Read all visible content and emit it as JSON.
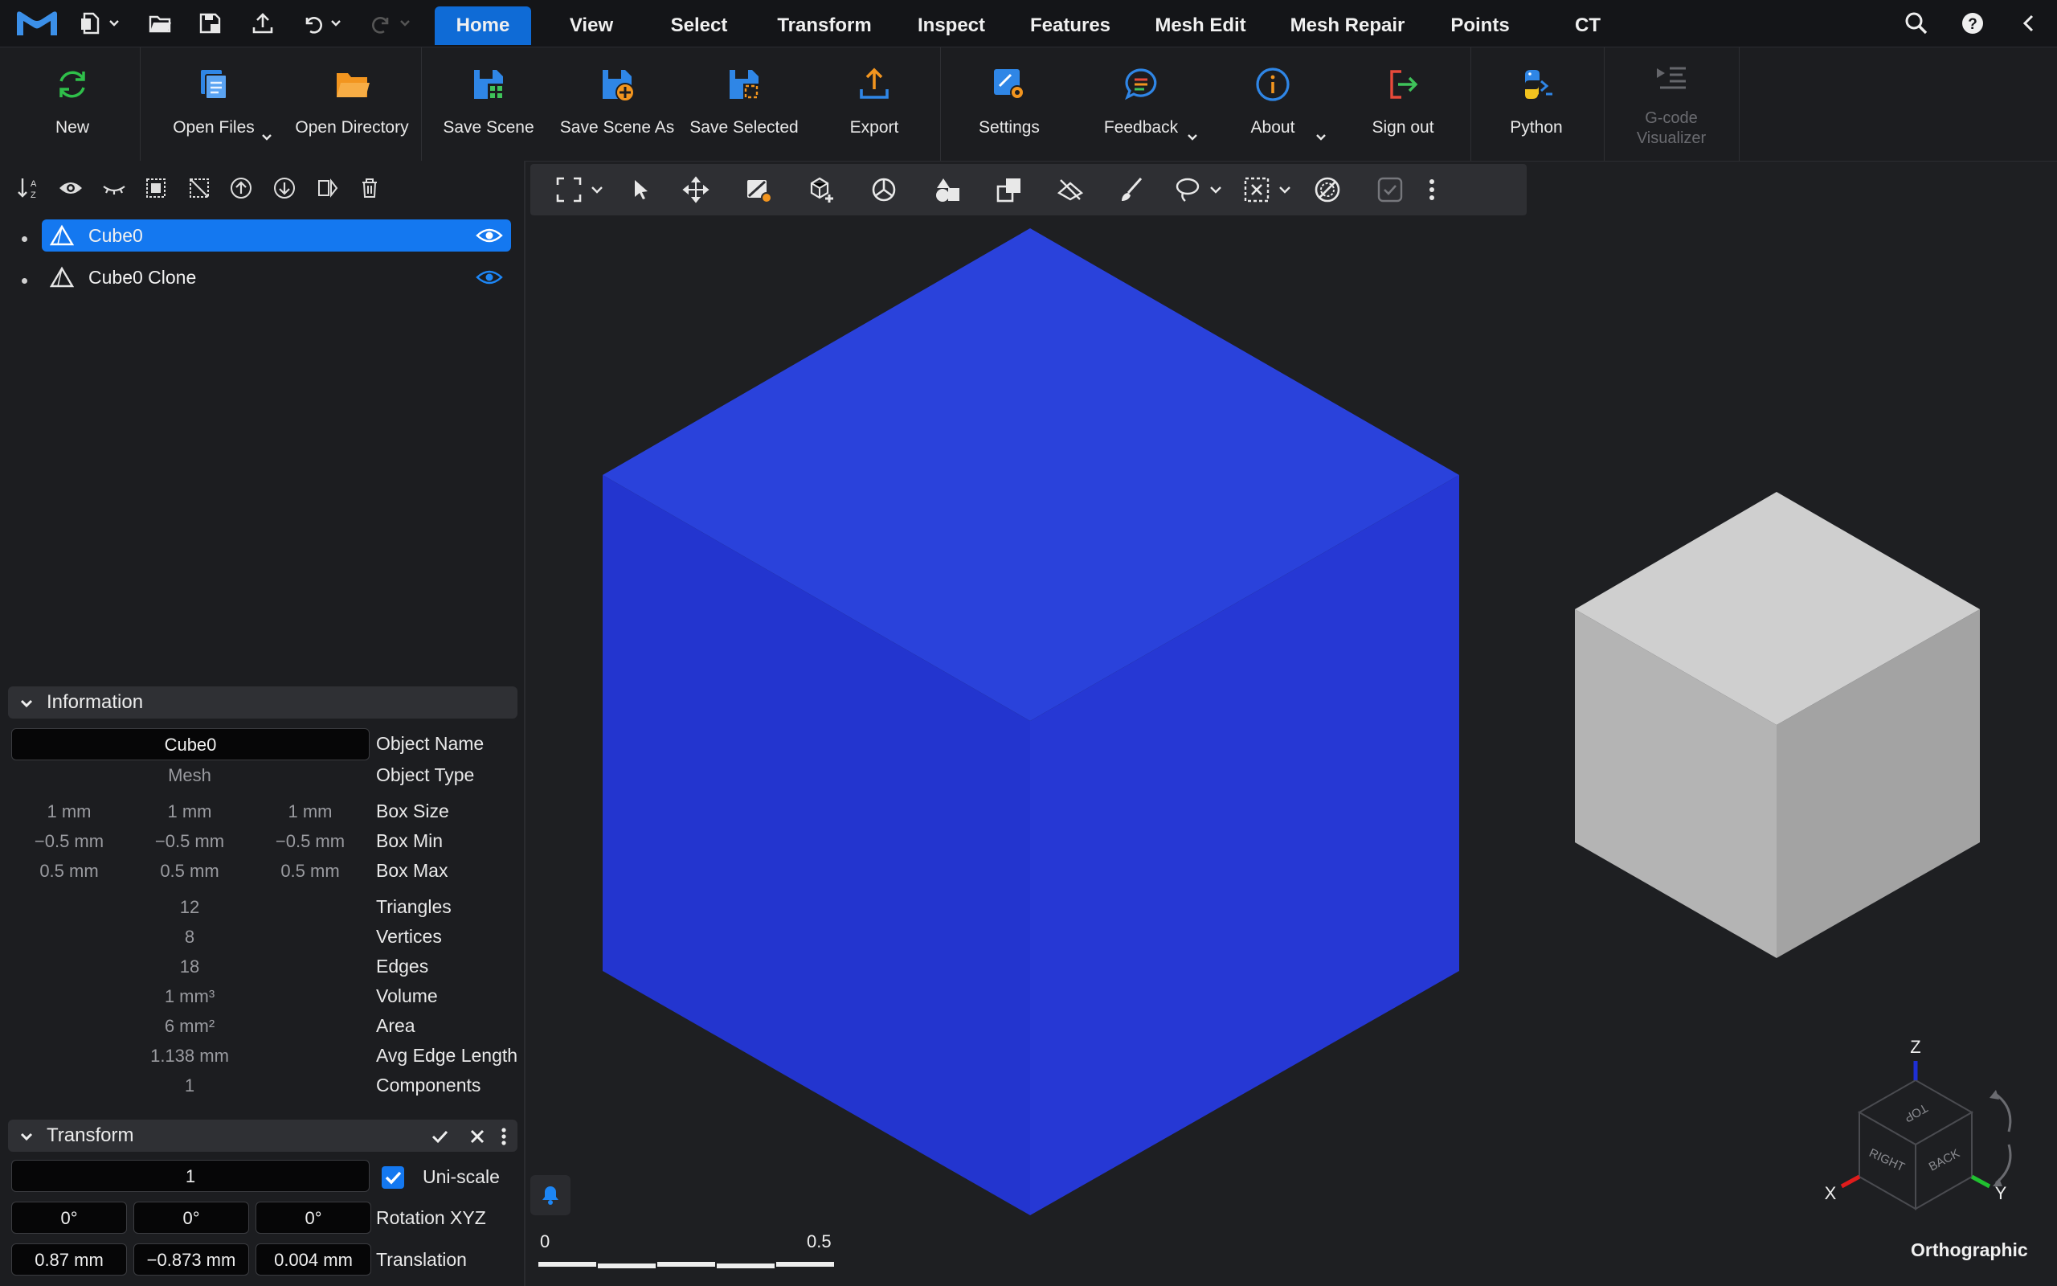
{
  "menu": {
    "tabs": [
      "Home",
      "View",
      "Select",
      "Transform",
      "Inspect",
      "Features",
      "Mesh Edit",
      "Mesh Repair",
      "Points",
      "CT"
    ],
    "active_tab": "Home"
  },
  "ribbon": {
    "new": "New",
    "open_files": "Open Files",
    "open_directory": "Open Directory",
    "save_scene": "Save Scene",
    "save_scene_as": "Save Scene As",
    "save_selected": "Save Selected",
    "export": "Export",
    "settings": "Settings",
    "feedback": "Feedback",
    "about": "About",
    "sign_out": "Sign out",
    "python": "Python",
    "gcode_visualizer": "G-code Visualizer"
  },
  "scene_tree": {
    "items": [
      {
        "name": "Cube0",
        "selected": true
      },
      {
        "name": "Cube0 Clone",
        "selected": false
      }
    ]
  },
  "information": {
    "header": "Information",
    "object_name_value": "Cube0",
    "object_name_label": "Object Name",
    "object_type_value": "Mesh",
    "object_type_label": "Object Type",
    "box_size": [
      "1 mm",
      "1 mm",
      "1 mm"
    ],
    "box_size_label": "Box Size",
    "box_min": [
      "−0.5 mm",
      "−0.5 mm",
      "−0.5 mm"
    ],
    "box_min_label": "Box Min",
    "box_max": [
      "0.5 mm",
      "0.5 mm",
      "0.5 mm"
    ],
    "box_max_label": "Box Max",
    "triangles": "12",
    "triangles_label": "Triangles",
    "vertices": "8",
    "vertices_label": "Vertices",
    "edges": "18",
    "edges_label": "Edges",
    "volume": "1 mm³",
    "volume_label": "Volume",
    "area": "6 mm²",
    "area_label": "Area",
    "avg_edge": "1.138 mm",
    "avg_edge_label": "Avg Edge Length",
    "components": "1",
    "components_label": "Components"
  },
  "transform": {
    "header": "Transform",
    "scale_value": "1",
    "uniscale_label": "Uni-scale",
    "uniscale_checked": true,
    "rotation": [
      "0°",
      "0°",
      "0°"
    ],
    "rotation_label": "Rotation XYZ",
    "translation": [
      "0.87 mm",
      "−0.873 mm",
      "0.004 mm"
    ],
    "translation_label": "Translation"
  },
  "viewport": {
    "projection": "Orthographic",
    "scale_start": "0",
    "scale_end": "0.5",
    "axis_labels": {
      "x": "X",
      "y": "Y",
      "z": "Z"
    },
    "cube_faces": {
      "top": "TOP",
      "right": "RIGHT",
      "back": "BACK"
    },
    "selected_cube_color": "#2b3fd8",
    "other_cube_color": "#c9c9c9"
  },
  "colors": {
    "accent": "#0f6bd6",
    "selection": "#1478f0",
    "background": "#1e1f22"
  }
}
